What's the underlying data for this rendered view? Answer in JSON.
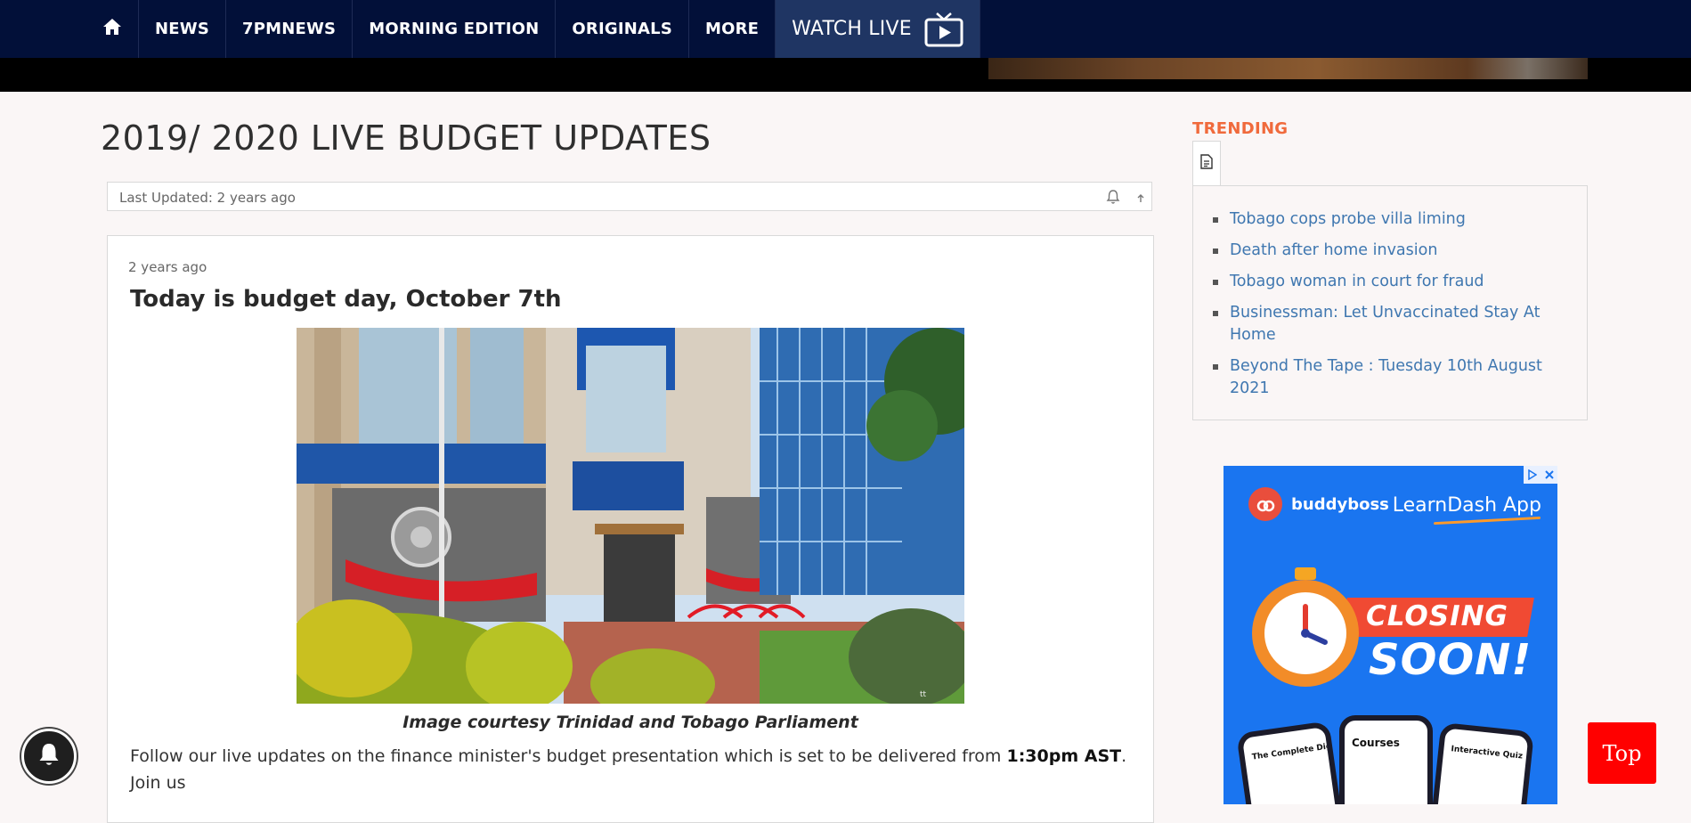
{
  "nav": {
    "home_icon": "home-icon",
    "items": [
      {
        "label": "NEWS"
      },
      {
        "label": "7PMNEWS"
      },
      {
        "label": "MORNING EDITION"
      },
      {
        "label": "ORIGINALS"
      },
      {
        "label": "MORE"
      }
    ],
    "watch_live": "WATCH LIVE",
    "watch_icon": "tv-play-icon"
  },
  "page": {
    "title": "2019/ 2020 LIVE BUDGET UPDATES",
    "last_updated": "Last Updated: 2 years ago",
    "bell_icon": "bell-icon",
    "up_icon": "arrow-up-icon"
  },
  "post": {
    "time": "2 years ago",
    "heading": "Today is budget day, October 7th",
    "image_alt": "Parliament building",
    "photo_watermark": "tt",
    "caption": "Image courtesy Trinidad and Tobago Parliament",
    "body_prefix": "Follow our live updates on the finance minister's budget presentation which is set to be delivered from ",
    "body_bold": "1:30pm AST",
    "body_suffix": ". Join us"
  },
  "sidebar": {
    "trending_title": "TRENDING",
    "tab_icon": "document-icon",
    "items": [
      {
        "label": "Tobago cops probe villa liming"
      },
      {
        "label": "Death after home invasion"
      },
      {
        "label": "Tobago woman in court for fraud"
      },
      {
        "label": "Businessman: Let Unvaccinated Stay At Home"
      },
      {
        "label": "Beyond The Tape : Tuesday 10th August 2021"
      }
    ]
  },
  "ad": {
    "brand": "buddyboss",
    "app": "LearnDash App",
    "line1": "CLOSING",
    "line2": "SOON!",
    "phone1": "The Complete Digital Marketing Course",
    "phone2": "Courses",
    "phone3": "Interactive Quiz",
    "adchoices_icon": "adchoices-icon",
    "close_icon": "close-icon"
  },
  "floating": {
    "notification_icon": "bell-icon",
    "top_label": "Top"
  },
  "colors": {
    "nav_bg": "#021039",
    "watch_bg": "#1f3563",
    "trending": "#f06a3c",
    "link": "#3f77b0",
    "top_button": "#ff0000",
    "ad_bg": "#1a75f0"
  }
}
